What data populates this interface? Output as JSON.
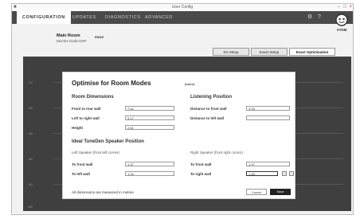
{
  "window": {
    "title": "User Config"
  },
  "nav": {
    "tabs": [
      {
        "label": "CONFIGURATION"
      },
      {
        "label": "UPDATES"
      },
      {
        "label": "DIAGNOSTICS"
      },
      {
        "label": "ADVANCED"
      }
    ],
    "icons": [
      "gear-icon",
      "help-icon"
    ]
  },
  "logo": {
    "text": "ATDM"
  },
  "device": {
    "name": "Main Room",
    "sub": "Monitor Dude DSP",
    "switch": "more"
  },
  "setup_buttons": [
    {
      "label": "DA Setup"
    },
    {
      "label": "Exact Setup"
    },
    {
      "label": "Exact Optimisation"
    }
  ],
  "modal": {
    "title": "Optimise for Room Modes",
    "badge": "(more)",
    "room_dimensions": {
      "heading": "Room Dimensions",
      "front_to_rear": {
        "label": "Front to rear wall",
        "value": "7.42"
      },
      "left_to_right": {
        "label": "Left to right wall",
        "value": "5.17"
      },
      "height": {
        "label": "Height",
        "value": "2.51"
      }
    },
    "listening_position": {
      "heading": "Listening Position",
      "distance_front": {
        "label": "Distance to front wall",
        "value": "3.33"
      },
      "distance_left": {
        "label": "Distance to left wall",
        "value": ""
      }
    },
    "speaker_position": {
      "heading": "Ideal TuneDen Speaker Position",
      "left_heading": "Left Speaker (front left corner)",
      "right_heading": "Right Speaker (front right corner)",
      "left_to_front": {
        "label": "To front wall",
        "value": "1.37"
      },
      "left_to_left": {
        "label": "To left wall",
        "value": "1.16"
      },
      "right_to_front": {
        "label": "To front wall",
        "value": "1.37"
      },
      "right_to_right": {
        "label": "To right wall",
        "value": "1.16"
      }
    },
    "note": "All dimensions are measured in metres",
    "cancel_label": "Cancel",
    "save_label": "Save"
  },
  "plot": {
    "y_labels": [
      "-10",
      "-20",
      "-30",
      "-40",
      "-50",
      "-60"
    ]
  }
}
